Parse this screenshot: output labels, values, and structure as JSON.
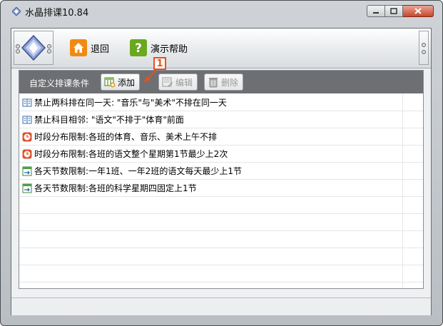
{
  "window": {
    "title": "水晶排课10.84"
  },
  "toolbar": {
    "back_label": "退回",
    "help_label": "演示帮助"
  },
  "panel": {
    "title": "自定义排课条件",
    "add_label": "添加",
    "edit_label": "编辑",
    "delete_label": "删除",
    "callout_number": "1"
  },
  "items": [
    {
      "icon": "book-icon",
      "text": "禁止两科排在同一天: \"音乐\"与\"美术\"不排在同一天"
    },
    {
      "icon": "book-icon",
      "text": "禁止科目相邻: \"语文\"不排于\"体育\"前面"
    },
    {
      "icon": "clock-icon",
      "text": "时段分布限制:各班的体育、音乐、美术上午不排"
    },
    {
      "icon": "clock-icon",
      "text": "时段分布限制:各班的语文整个星期第1节最少上2次"
    },
    {
      "icon": "schedule-icon",
      "text": "各天节数限制:一年1班、一年2班的语文每天最少上1节"
    },
    {
      "icon": "schedule-icon",
      "text": "各天节数限制:各班的科学星期四固定上1节"
    }
  ],
  "colors": {
    "accent_orange": "#e8501c",
    "header_gray": "#6d6f72",
    "help_green": "#6aa81e",
    "home_orange": "#f08a12"
  }
}
